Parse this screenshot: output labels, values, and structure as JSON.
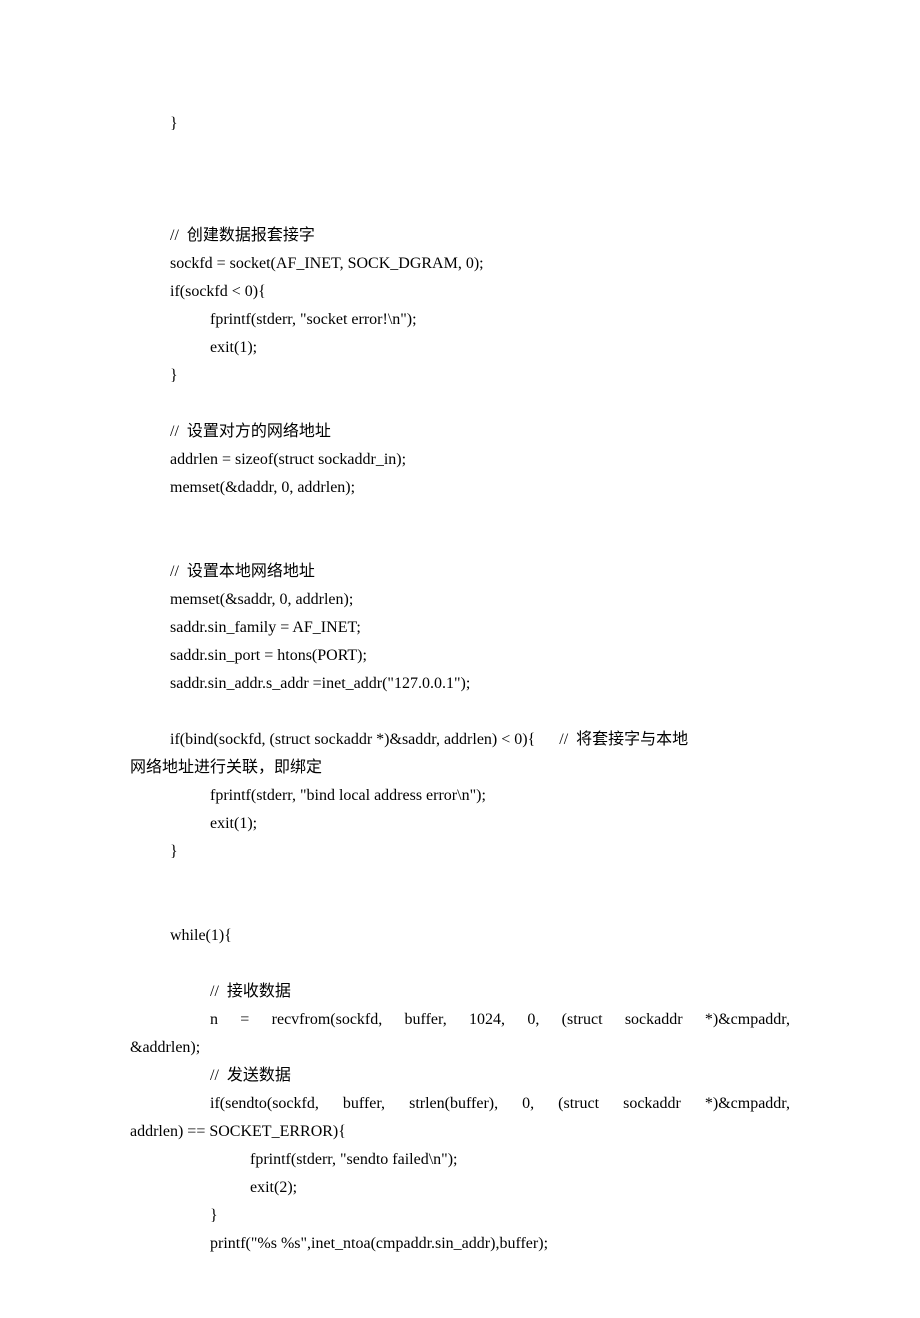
{
  "code": {
    "l01": "}",
    "l02": "//  创建数据报套接字",
    "l03": "sockfd = socket(AF_INET, SOCK_DGRAM, 0);",
    "l04": "if(sockfd < 0){",
    "l05": "fprintf(stderr, \"socket error!\\n\");",
    "l06": "exit(1);",
    "l07": "}",
    "l08": "//  设置对方的网络地址",
    "l09": "addrlen = sizeof(struct sockaddr_in);",
    "l10": "memset(&daddr, 0, addrlen);",
    "l11": "//  设置本地网络地址",
    "l12": "memset(&saddr, 0, addrlen);",
    "l13": "saddr.sin_family = AF_INET;",
    "l14": "saddr.sin_port = htons(PORT);",
    "l15": "saddr.sin_addr.s_addr =inet_addr(\"127.0.0.1\");",
    "l16a": "if(bind(sockfd, (struct sockaddr *)&saddr, addrlen) < 0){      //  将套接字与本地",
    "l16b": "网络地址进行关联，即绑定",
    "l17": "fprintf(stderr, \"bind local address error\\n\");",
    "l18": "exit(1);",
    "l19": "}",
    "l20": "while(1){",
    "l21": "//  接收数据",
    "l22a": "n  =  recvfrom(sockfd,  buffer,  1024,  0,  (struct  sockaddr  *)&cmpaddr,",
    "l22b": "&addrlen);",
    "l23": "//  发送数据",
    "l24a": "if(sendto(sockfd,  buffer,  strlen(buffer),  0,  (struct  sockaddr  *)&cmpaddr,",
    "l24b": "addrlen) == SOCKET_ERROR){",
    "l25": "fprintf(stderr, \"sendto failed\\n\");",
    "l26": "exit(2);",
    "l27": "}",
    "l28": "printf(\"%s %s\",inet_ntoa(cmpaddr.sin_addr),buffer);"
  }
}
